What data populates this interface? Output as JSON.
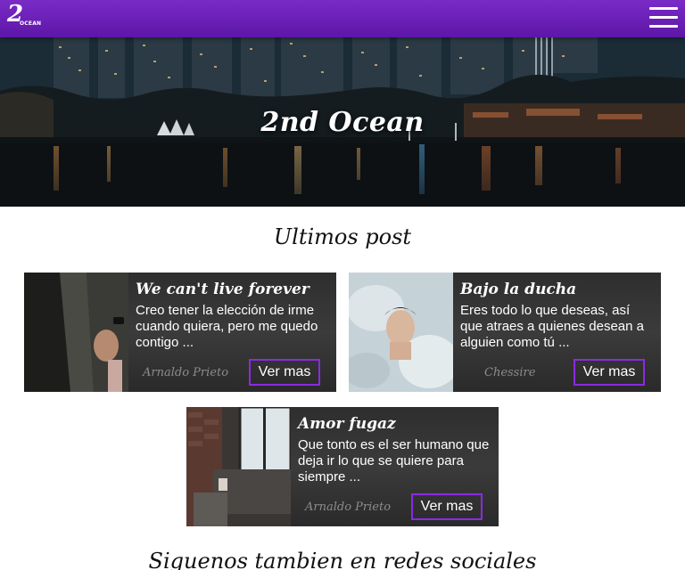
{
  "header": {
    "logo_number": "2",
    "logo_sub": "OCEAN",
    "accent_color": "#6a1fb5",
    "menu_icon": "hamburger-menu-icon"
  },
  "hero": {
    "title": "2nd Ocean"
  },
  "latest": {
    "heading": "Ultimos post",
    "posts": [
      {
        "title": "We can't live forever",
        "excerpt": "Creo tener la elección de irme cuando quiera, pero me quedo contigo ...",
        "author": "Arnaldo Prieto",
        "button": "Ver mas"
      },
      {
        "title": "Bajo la ducha",
        "excerpt": "Eres todo lo que deseas, así que atraes a quienes desean a alguien como tú ...",
        "author": "Chessire",
        "button": "Ver mas"
      },
      {
        "title": "Amor fugaz",
        "excerpt": "Que tonto es el ser humano que deja ir lo que se quiere para siempre ...",
        "author": "Arnaldo Prieto",
        "button": "Ver mas"
      }
    ]
  },
  "social": {
    "heading": "Siguenos tambien en redes sociales"
  }
}
